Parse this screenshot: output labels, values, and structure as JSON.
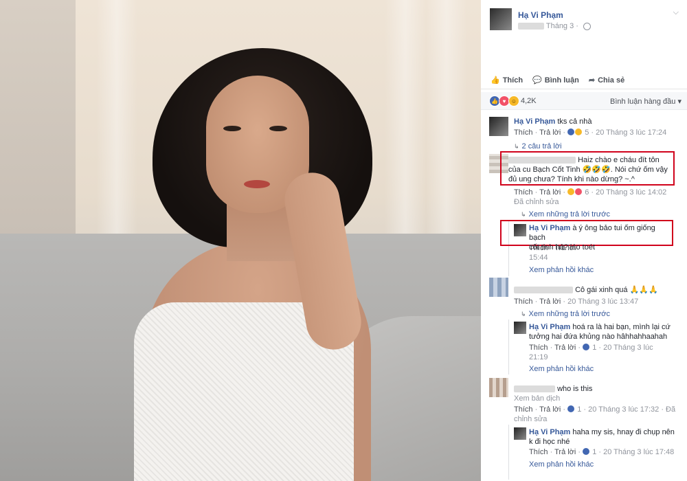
{
  "post": {
    "author": "Hạ Vi Phạm",
    "date_suffix": "Tháng 3 ·",
    "actions": {
      "like": "Thích",
      "comment": "Bình luận",
      "share": "Chia sẻ"
    },
    "reaction_count": "4,2K",
    "sort_label": "Bình luận hàng đầu"
  },
  "comments": [
    {
      "author": "Hạ Vi Phạm",
      "text": "tks cả nhà",
      "like": "Thích",
      "reply": "Trả lời",
      "reactions": "5",
      "time": "20 Tháng 3 lúc 17:24"
    },
    {
      "replies_link": "2 câu trả lời"
    },
    {
      "text_line1": "Haiz chào e cháu đít tôn",
      "text_line2": "của cu Bạch Cốt Tinh 🤣🤣🤣. Nói chứ ốm vậy",
      "text_line3": "đủ ung chưa? Tính khi nào dừng? ~.^",
      "like": "Thích",
      "reply": "Trả lời",
      "reactions": "6",
      "time": "20 Tháng 3 lúc 14:02",
      "edited": "Đã chỉnh sửa",
      "prev_replies": "Xem những trả lời trước"
    },
    {
      "author": "Hạ Vi Phạm",
      "text_line1": "à ý ông bảo tui ốm giống bạch",
      "text_line2": "cốt tinh hả? láo toét",
      "like": "Thích",
      "reply": "Trả lời",
      "time": "15:44",
      "more": "Xem phản hồi khác"
    },
    {
      "text": "Cô gái xinh quá 🙏🙏🙏",
      "like": "Thích",
      "reply": "Trả lời",
      "time": "20 Tháng 3 lúc 13:47",
      "prev_replies": "Xem những trả lời trước"
    },
    {
      "author": "Hạ Vi Phạm",
      "text_line1": "hoá ra là hai bạn, mình lại cứ",
      "text_line2": "tưởng hai đứa khủng nào hâhhahhaahah",
      "like": "Thích",
      "reply": "Trả lời",
      "reactions": "1",
      "time_a": "20 Tháng 3 lúc",
      "time_b": "21:19",
      "more": "Xem phản hồi khác"
    },
    {
      "text": "who is this",
      "translate": "Xem bản dịch",
      "like": "Thích",
      "reply": "Trả lời",
      "reactions": "1",
      "time": "20 Tháng 3 lúc 17:32",
      "edited_a": "Đã",
      "edited_b": "chỉnh sửa"
    },
    {
      "author": "Hạ Vi Phạm",
      "text_line1": "haha my sis, hnay đi chụp nên",
      "text_line2": "k đi học nhé",
      "like": "Thích",
      "reply": "Trả lời",
      "reactions": "1",
      "time": "20 Tháng 3 lúc 17:48",
      "more": "Xem phản hồi khác"
    }
  ],
  "colors": {
    "link": "#365899",
    "meta": "#90949c",
    "highlight": "#d0021b"
  },
  "icons": [
    "like-icon",
    "comment-icon",
    "share-icon",
    "globe-icon",
    "chevron-down-icon"
  ]
}
